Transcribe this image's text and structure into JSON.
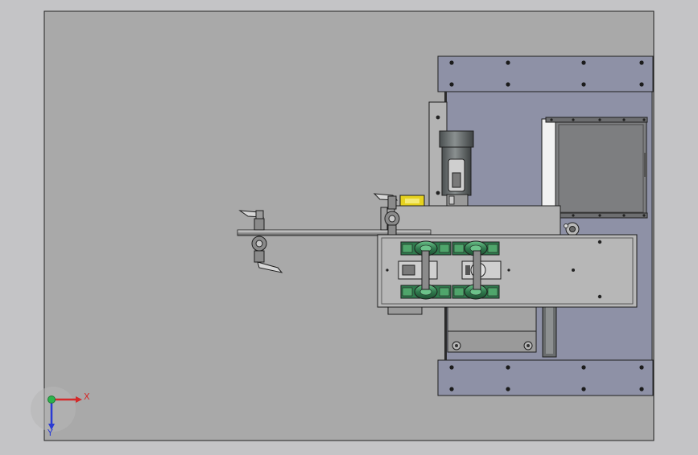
{
  "app": {
    "kind": "CAD drawing viewport"
  },
  "colors": {
    "outer_bg": "#c4c4c6",
    "sheet": "#a9a9a9",
    "frame_plate": "#8e91a6",
    "metal_light": "#b7b7b7",
    "metal_mid": "#9c9c9c",
    "metal_dark": "#5d6162",
    "outline": "#1e1e1e",
    "bearing_green": "#2f7a4d",
    "bearing_green_light": "#4fa56b",
    "warning_yellow": "#e6d21e",
    "axis_x": "#d42a2a",
    "axis_y": "#2a3bd4",
    "axis_origin": "#2cb34a"
  },
  "triad": {
    "x_label": "X",
    "y_label": "Y",
    "icon": "coordinate-triad-icon"
  }
}
